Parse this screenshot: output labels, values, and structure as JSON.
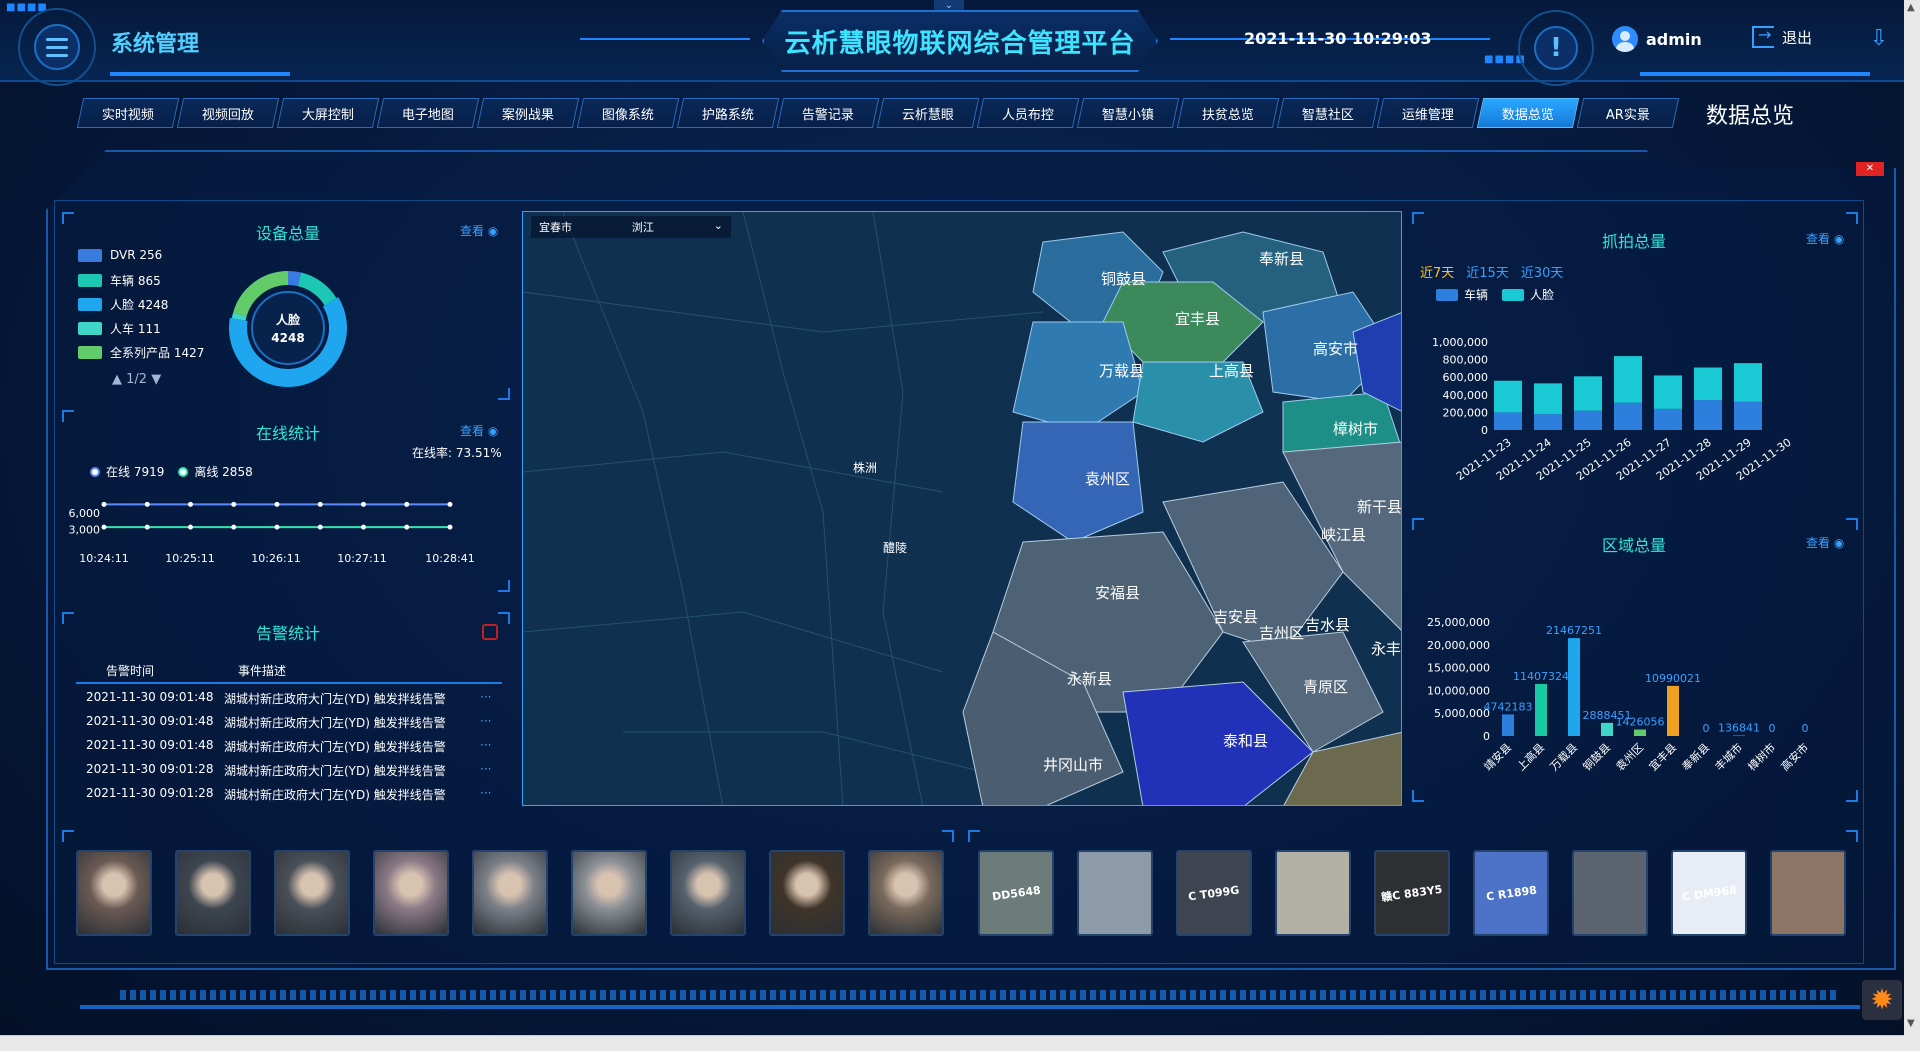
{
  "header": {
    "system_title": "系统管理",
    "main_title": "云析慧眼物联网综合管理平台",
    "datetime": "2021-11-30 10:29:03",
    "user": "admin",
    "logout": "退出",
    "collapse_glyph": "⌄",
    "alert_glyph": "!",
    "download_glyph": "⇩"
  },
  "nav": {
    "tabs": [
      "实时视频",
      "视频回放",
      "大屏控制",
      "电子地图",
      "案例战果",
      "图像系统",
      "护路系统",
      "告警记录",
      "云析慧眼",
      "人员布控",
      "智慧小镇",
      "扶贫总览",
      "智慧社区",
      "运维管理",
      "数据总览",
      "AR实景"
    ],
    "active": "数据总览",
    "page_heading": "数据总览"
  },
  "device_panel": {
    "title": "设备总量",
    "view": "查看",
    "legend": [
      {
        "label": "DVR 256",
        "name": "DVR",
        "value": 256,
        "color": "#3a7be0"
      },
      {
        "label": "车辆 865",
        "name": "车辆",
        "value": 865,
        "color": "#1cc8b4"
      },
      {
        "label": "人脸 4248",
        "name": "人脸",
        "value": 4248,
        "color": "#1ea7ef"
      },
      {
        "label": "人车 111",
        "name": "人车",
        "value": 111,
        "color": "#3fd6c8"
      },
      {
        "label": "全系列产品 1427",
        "name": "全系列产品",
        "value": 1427,
        "color": "#62cc6a"
      }
    ],
    "center_label": "人脸",
    "center_value": "4248",
    "pager": "1/2"
  },
  "online_panel": {
    "title": "在线统计",
    "view": "查看",
    "online": "在线 7919",
    "offline": "离线 2858",
    "rate": "在线率: 73.51%",
    "online_color": "#5d8cff",
    "offline_color": "#2ee6b0"
  },
  "alarm_panel": {
    "title": "告警统计",
    "col_time": "告警时间",
    "col_desc": "事件描述",
    "rows": [
      {
        "time": "2021-11-30 09:01:48",
        "desc": "湖城村新庄政府大门左(YD) 触发拌线告警",
        "more": "···"
      },
      {
        "time": "2021-11-30 09:01:48",
        "desc": "湖城村新庄政府大门左(YD) 触发拌线告警",
        "more": "···"
      },
      {
        "time": "2021-11-30 09:01:48",
        "desc": "湖城村新庄政府大门左(YD) 触发拌线告警",
        "more": "···"
      },
      {
        "time": "2021-11-30 09:01:28",
        "desc": "湖城村新庄政府大门左(YD) 触发拌线告警",
        "more": "···"
      },
      {
        "time": "2021-11-30 09:01:28",
        "desc": "湖城村新庄政府大门左(YD) 触发拌线告警",
        "more": "···"
      }
    ]
  },
  "map": {
    "city_select": "宜春市",
    "city_select_value": "浏江",
    "labels": [
      "铜鼓县",
      "奉新县",
      "宜丰县",
      "万载县",
      "上高县",
      "高安市",
      "袁州区",
      "樟树市",
      "新干县",
      "峡江县",
      "安福县",
      "吉安县",
      "吉州区",
      "吉水县",
      "永丰县",
      "永新县",
      "青原区",
      "泰和县",
      "井冈山市",
      "株洲",
      "醴陵",
      "宜春市"
    ]
  },
  "capture_panel": {
    "title": "抓拍总量",
    "view": "查看",
    "ranges": [
      "近7天",
      "近15天",
      "近30天"
    ],
    "active_range": "近7天",
    "legend": [
      {
        "name": "车辆",
        "color": "#2c7fdc"
      },
      {
        "name": "人脸",
        "color": "#19c9d3"
      }
    ]
  },
  "region_panel": {
    "title": "区域总量",
    "view": "查看"
  },
  "chart_data": [
    {
      "type": "pie",
      "title": "设备总量",
      "categories": [
        "DVR",
        "车辆",
        "人脸",
        "人车",
        "全系列产品"
      ],
      "values": [
        256,
        865,
        4248,
        111,
        1427
      ]
    },
    {
      "type": "line",
      "title": "在线统计",
      "x": [
        "10:24:11",
        "10:25:11",
        "10:26:11",
        "10:27:11",
        "10:28:41"
      ],
      "series": [
        {
          "name": "在线",
          "values": [
            7919,
            7919,
            7919,
            7919,
            7919,
            7919,
            7919,
            7919,
            7919
          ]
        },
        {
          "name": "离线",
          "values": [
            2858,
            2858,
            2858,
            2858,
            2858,
            2858,
            2858,
            2858,
            2858
          ]
        }
      ],
      "yticks": [
        "6,000",
        "3,000"
      ],
      "ylim": [
        0,
        8000
      ]
    },
    {
      "type": "bar",
      "title": "抓拍总量",
      "categories": [
        "2021-11-23",
        "2021-11-24",
        "2021-11-25",
        "2021-11-26",
        "2021-11-27",
        "2021-11-28",
        "2021-11-29",
        "2021-11-30"
      ],
      "series": [
        {
          "name": "车辆",
          "values": [
            200000,
            180000,
            220000,
            310000,
            240000,
            340000,
            320000
          ]
        },
        {
          "name": "人脸",
          "values": [
            360000,
            350000,
            390000,
            530000,
            380000,
            370000,
            440000
          ]
        }
      ],
      "yticks": [
        "1,000,000",
        "800,000",
        "600,000",
        "400,000",
        "200,000",
        "0"
      ],
      "ylim": [
        0,
        1000000
      ]
    },
    {
      "type": "bar",
      "title": "区域总量",
      "categories": [
        "靖安县",
        "上高县",
        "万载县",
        "铜鼓县",
        "袁州区",
        "宜丰县",
        "奉新县",
        "丰城市",
        "樟树市",
        "高安市"
      ],
      "values": [
        4742183,
        11407324,
        21467251,
        2888451,
        1426056,
        10990021,
        0,
        136841,
        0,
        0
      ],
      "labels": [
        "4742183",
        "11407324",
        "21467251",
        "2888451",
        "1426056",
        "10990021",
        "0",
        "136841",
        "0",
        "0"
      ],
      "yticks": [
        "25,000,000",
        "20,000,000",
        "15,000,000",
        "10,000,000",
        "5,000,000",
        "0"
      ],
      "ylim": [
        0,
        25000000
      ]
    }
  ],
  "thumbnails": {
    "faces": [
      "face-1",
      "face-2",
      "face-3",
      "face-4",
      "face-5",
      "face-6",
      "face-7",
      "face-8",
      "face-9"
    ],
    "vehicles": [
      "vehicle-1",
      "vehicle-2",
      "vehicle-3",
      "vehicle-4",
      "vehicle-5",
      "vehicle-6",
      "vehicle-7",
      "vehicle-8",
      "vehicle-9"
    ],
    "plate_texts": [
      "DD5648",
      "",
      "C T099G",
      "",
      "赣C 883Y5",
      "C R1898",
      "",
      "C DM968",
      ""
    ]
  }
}
